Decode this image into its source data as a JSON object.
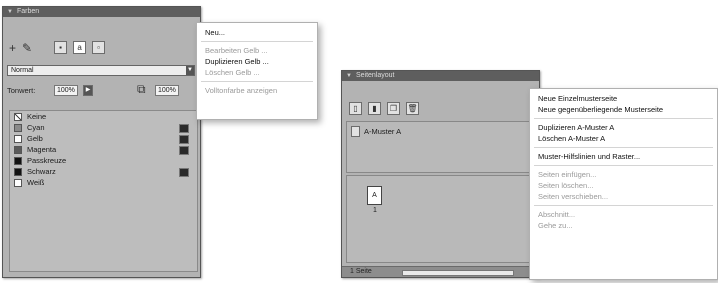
{
  "swatches_panel": {
    "title": "",
    "tab": "Farben",
    "tint_label": "Tonwert:",
    "tint_value": "100%",
    "tint_value_right": "100%",
    "blend_mode": "Normal",
    "swatches": [
      {
        "name": "Keine",
        "color": "#ffffff"
      },
      {
        "name": "Cyan",
        "color": "#8a8a8a"
      },
      {
        "name": "Gelb",
        "color": "#ffffff"
      },
      {
        "name": "Magenta",
        "color": "#5a5a5a"
      },
      {
        "name": "Passkreuze",
        "color": "#111111"
      },
      {
        "name": "Schwarz",
        "color": "#111111"
      },
      {
        "name": "Weiß",
        "color": "#ffffff"
      }
    ]
  },
  "swatches_menu": {
    "items": [
      {
        "label": "Neu...",
        "enabled": true
      },
      {
        "label": "Bearbeiten Gelb ...",
        "enabled": false
      },
      {
        "label": "Duplizieren Gelb ...",
        "enabled": true
      },
      {
        "label": "Löschen Gelb ...",
        "enabled": false
      },
      {
        "label": "Vollton­farbe anzeigen",
        "enabled": false
      }
    ]
  },
  "page_layout_panel": {
    "title": "Seitenlayout",
    "master_name": "A-Muster A",
    "page_tile_label": "A",
    "page_number": "1",
    "footer_text": "1 Seite"
  },
  "page_layout_menu": {
    "items": [
      {
        "label": "Neue Einzelmusterseite",
        "enabled": true
      },
      {
        "label": "Neue gegenüberliegende Musterseite",
        "enabled": true
      },
      {
        "label": "Duplizieren A-Muster A",
        "enabled": true
      },
      {
        "label": "Löschen A-Muster A",
        "enabled": true
      },
      {
        "label": "Muster-Hilfslinien und Raster...",
        "enabled": true
      },
      {
        "label": "Seiten einfügen...",
        "enabled": false
      },
      {
        "label": "Seiten löschen...",
        "enabled": false
      },
      {
        "label": "Seiten verschieben...",
        "enabled": false
      },
      {
        "label": "Abschnitt...",
        "enabled": false
      },
      {
        "label": "Gehe zu...",
        "enabled": false
      }
    ]
  },
  "colors": {
    "panel_bg": "#b3b3b3",
    "titlebar": "#5e5e5e",
    "menu_bg": "#ffffff"
  }
}
